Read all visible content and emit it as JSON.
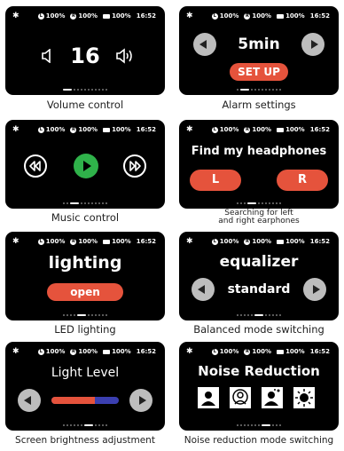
{
  "status": {
    "bluetooth": "✱",
    "left": "100%",
    "right": "100%",
    "case": "100%",
    "time": "16:52",
    "left_badge": "L",
    "right_badge": "R"
  },
  "cards": {
    "volume": {
      "value": "16",
      "caption": "Volume control"
    },
    "alarm": {
      "value": "5min",
      "button": "SET UP",
      "caption": "Alarm settings"
    },
    "music": {
      "caption": "Music control"
    },
    "find": {
      "title": "Find my headphones",
      "left": "L",
      "right": "R",
      "caption_line1": "Searching for left",
      "caption_line2": "and right earphones"
    },
    "led": {
      "title": "lighting",
      "button": "open",
      "caption": "LED lighting"
    },
    "eq": {
      "title": "equalizer",
      "value": "standard",
      "caption": "Balanced mode switching"
    },
    "light": {
      "title": "Light Level",
      "level": 0.65,
      "caption": "Screen brightness adjustment"
    },
    "noise": {
      "title": "Noise Reduction",
      "caption": "Noise reduction mode switching"
    }
  },
  "colors": {
    "accent": "#e5533c",
    "play": "#2fb24a",
    "slider_blue": "#3b3fb0",
    "circle": "#bdbdbd"
  }
}
